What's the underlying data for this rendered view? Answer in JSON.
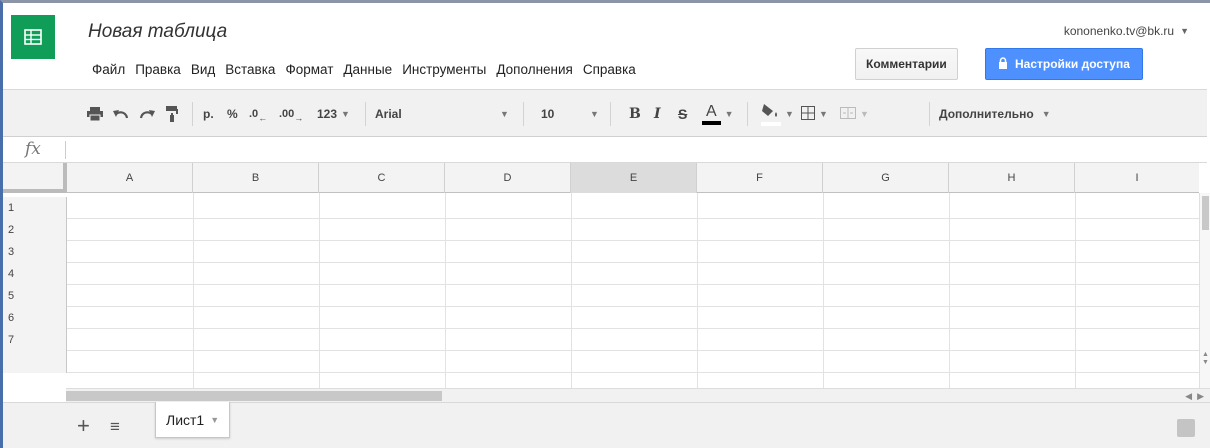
{
  "header": {
    "title": "Новая таблица",
    "user_email": "kononenko.tv@bk.ru",
    "comments_label": "Комментарии",
    "share_label": "Настройки доступа"
  },
  "menu": [
    "Файл",
    "Правка",
    "Вид",
    "Вставка",
    "Формат",
    "Данные",
    "Инструменты",
    "Дополнения",
    "Справка"
  ],
  "toolbar": {
    "currency": "р.",
    "percent": "%",
    "decrease_decimals": ".0",
    "increase_decimals": ".00",
    "more_formats": "123",
    "font": "Arial",
    "font_size": "10",
    "bold": "B",
    "italic": "I",
    "strike": "S",
    "text_color": "A",
    "more": "Дополнительно"
  },
  "formula_bar": {
    "fx": "fx",
    "value": ""
  },
  "grid": {
    "columns": [
      "A",
      "B",
      "C",
      "D",
      "E",
      "F",
      "G",
      "H",
      "I"
    ],
    "selected_column": "E",
    "rows": [
      "1",
      "2",
      "3",
      "4",
      "5",
      "6",
      "7"
    ]
  },
  "sheets": {
    "tabs": [
      "Лист1"
    ]
  },
  "colors": {
    "logo": "#0f9d58",
    "share_button": "#4d90fe",
    "toolbar_bg": "#f1f1f1"
  }
}
